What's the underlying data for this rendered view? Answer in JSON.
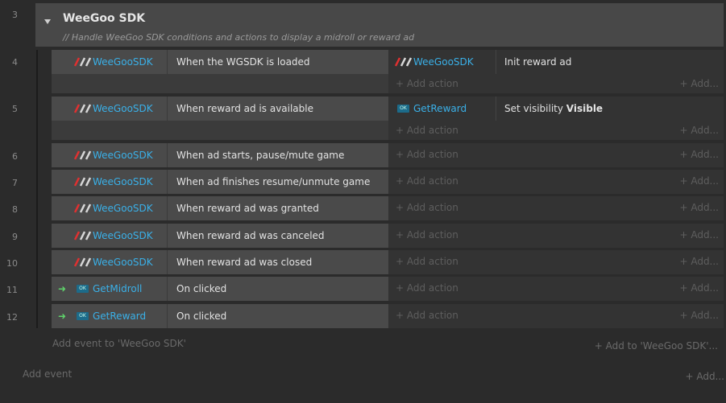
{
  "group": {
    "line": "3",
    "title": "WeeGoo SDK",
    "description": "//  Handle WeeGoo SDK conditions and actions to display a midroll or reward ad"
  },
  "events": [
    {
      "line": "4",
      "cond_icon": "weegoo-logo-icon",
      "cond_object": "WeeGooSDK",
      "cond_text": "When the WGSDK is loaded",
      "action_icon": "weegoo-logo-icon",
      "action_object": "WeeGooSDK",
      "action_text": "Init reward ad",
      "action_bold": ""
    },
    {
      "line": "5",
      "cond_icon": "weegoo-logo-icon",
      "cond_object": "WeeGooSDK",
      "cond_text": "When reward ad is available",
      "action_icon": "button-object-icon",
      "action_object": "GetReward",
      "action_text": "Set visibility ",
      "action_bold": "Visible"
    },
    {
      "line": "6",
      "cond_icon": "weegoo-logo-icon",
      "cond_object": "WeeGooSDK",
      "cond_text": "When ad starts, pause/mute game"
    },
    {
      "line": "7",
      "cond_icon": "weegoo-logo-icon",
      "cond_object": "WeeGooSDK",
      "cond_text": "When ad finishes resume/unmute game"
    },
    {
      "line": "8",
      "cond_icon": "weegoo-logo-icon",
      "cond_object": "WeeGooSDK",
      "cond_text": "When reward ad was granted"
    },
    {
      "line": "9",
      "cond_icon": "weegoo-logo-icon",
      "cond_object": "WeeGooSDK",
      "cond_text": "When reward ad was canceled"
    },
    {
      "line": "10",
      "cond_icon": "weegoo-logo-icon",
      "cond_object": "WeeGooSDK",
      "cond_text": "When reward ad was closed"
    },
    {
      "line": "11",
      "cond_icon": "button-object-icon",
      "cond_object": "GetMidroll",
      "cond_text": "On clicked"
    },
    {
      "line": "12",
      "cond_icon": "button-object-icon",
      "cond_object": "GetReward",
      "cond_text": "On clicked"
    }
  ],
  "labels": {
    "add_action": "+ Add action",
    "add_short": "+ Add...",
    "add_event_to_group": "Add event to 'WeeGoo SDK'",
    "add_to_group": "+ Add to 'WeeGoo SDK'...",
    "add_event": "Add event",
    "add_bottom": "+ Add..."
  },
  "colors": {
    "object_name": "#3ab0e8",
    "trigger_arrow": "#5fd36b",
    "logo_red": "#e03030"
  }
}
